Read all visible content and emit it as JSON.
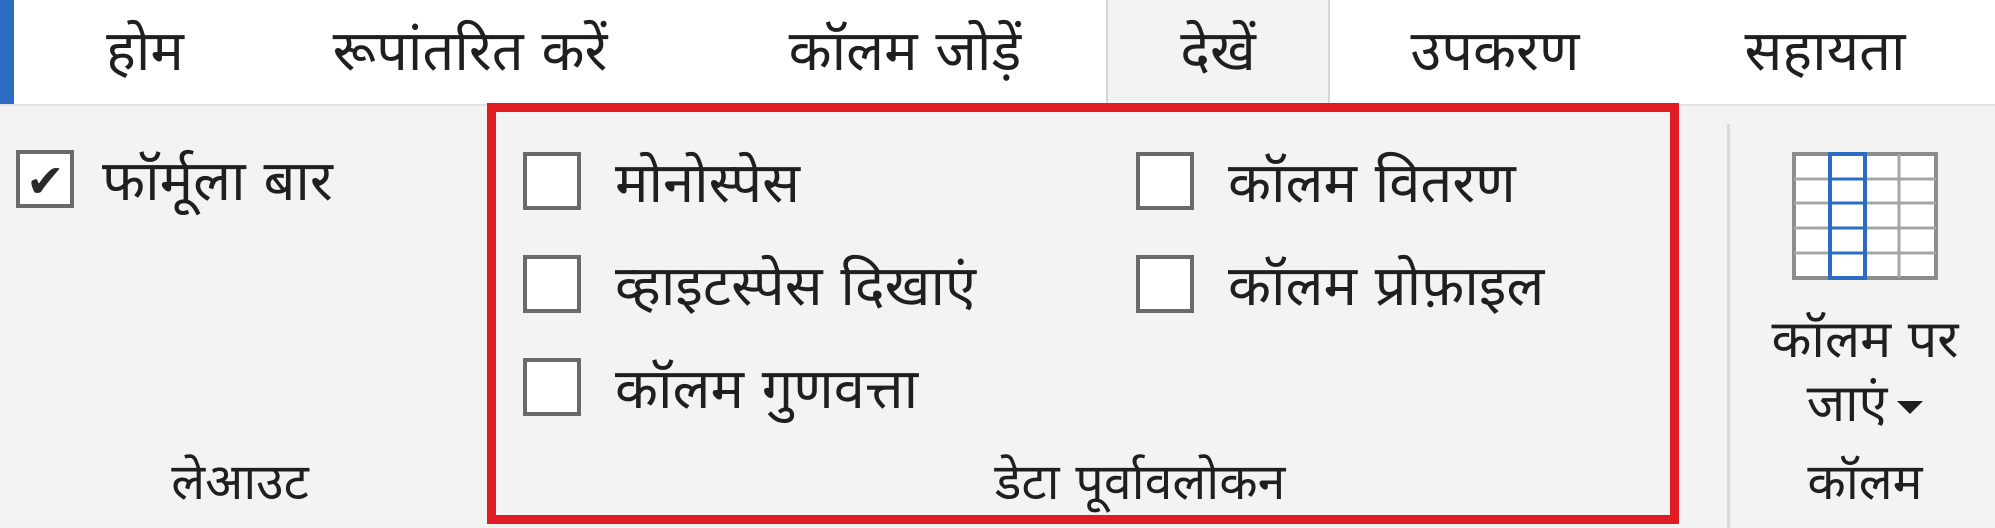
{
  "tabs": [
    "होम",
    "रूपांतरित करें",
    "कॉलम जोड़ें",
    "देखें",
    "उपकरण",
    "सहायता"
  ],
  "active_tab": "देखें",
  "layout_group": {
    "formula_bar": {
      "label": "फॉर्मूला बार",
      "checked": true
    },
    "group_label": "लेआउट"
  },
  "data_preview_group": {
    "monospace": {
      "label": "मोनोस्पेस",
      "checked": false
    },
    "show_whitespace": {
      "label": "व्हाइटस्पेस दिखाएं",
      "checked": false
    },
    "column_quality": {
      "label": "कॉलम गुणवत्ता",
      "checked": false
    },
    "column_distribution": {
      "label": "कॉलम वितरण",
      "checked": false
    },
    "column_profile": {
      "label": "कॉलम प्रोफ़ाइल",
      "checked": false
    },
    "group_label": "डेटा पूर्वावलोकन"
  },
  "columns_group": {
    "go_to_column": {
      "line1": "कॉलम पर",
      "line2": "जाएं"
    },
    "group_label": "कॉलम",
    "icon": "table-column-icon"
  },
  "colors": {
    "accent": "#2b6cc4",
    "highlight": "#e01b24",
    "ribbon_bg": "#f3f3f3"
  }
}
